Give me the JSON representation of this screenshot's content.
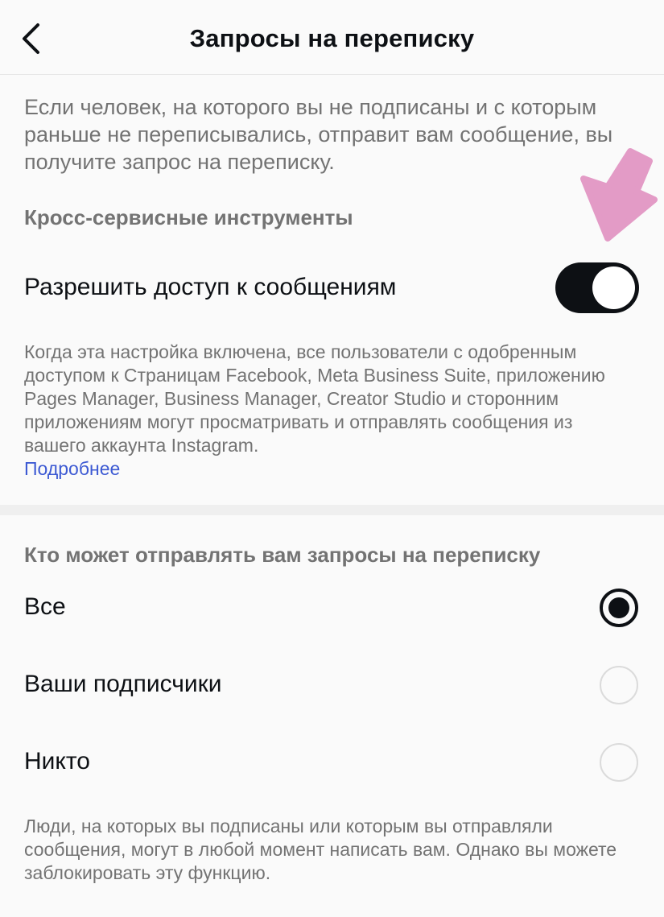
{
  "header": {
    "back_icon": "chevron-left-icon",
    "title": "Запросы на переписку"
  },
  "intro_text": "Если человек, на которого вы не подписаны и с которым раньше не переписывались, отправит вам сообщение, вы получите запрос на переписку.",
  "cross_service": {
    "heading": "Кросс-сервисные инструменты",
    "toggle_label": "Разрешить доступ к сообщениям",
    "toggle_on": true,
    "description": "Когда эта настройка включена, все пользователи с одобренным доступом к Страницам Facebook, Meta Business Suite, приложению Pages Manager, Business Manager, Creator Studio и сторонним приложениям могут просматривать и отправлять сообщения из вашего аккаунта Instagram.",
    "learn_more": "Подробнее"
  },
  "requests": {
    "heading": "Кто может отправлять вам запросы на переписку",
    "options": [
      {
        "label": "Все",
        "selected": true
      },
      {
        "label": "Ваши подписчики",
        "selected": false
      },
      {
        "label": "Никто",
        "selected": false
      }
    ],
    "note": "Люди, на которых вы подписаны или которым вы отправляли сообщения, могут в любой момент написать вам. Однако вы можете заблокировать эту функцию."
  },
  "colors": {
    "background": "#fafafa",
    "text_primary": "#0d1014",
    "text_secondary": "#737373",
    "link": "#3d5ad3",
    "annotation_arrow": "#e39bc6"
  }
}
